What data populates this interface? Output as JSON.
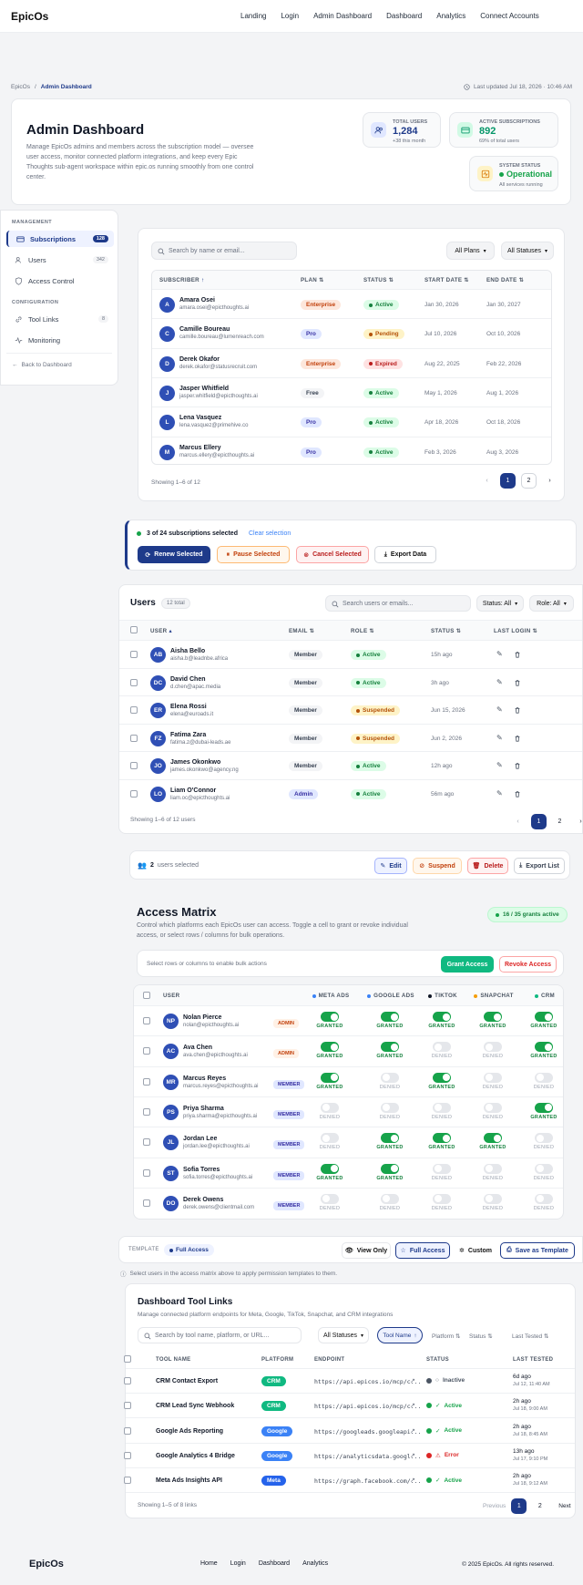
{
  "nav": {
    "brand": "EpicOs",
    "links": [
      "Landing",
      "Login",
      "Admin Dashboard",
      "Dashboard",
      "Analytics",
      "Connect Accounts"
    ]
  },
  "breadcrumb": {
    "root": "EpicOs",
    "sep": "/",
    "current": "Admin Dashboard"
  },
  "last_updated": "Last updated Jul 18, 2026 · 10:46 AM",
  "hero": {
    "title": "Admin Dashboard",
    "description": "Manage EpicOs admins and members across the subscription model — oversee user access, monitor connected platform integrations, and keep every Epic Thoughts sub-agent workspace within epic.os running smoothly from one control center."
  },
  "stats": [
    {
      "label": "TOTAL USERS",
      "value": "1,284",
      "sub": "+38 this month",
      "color": "#1e3a8a"
    },
    {
      "label": "ACTIVE SUBSCRIPTIONS",
      "value": "892",
      "sub": "69% of total users",
      "color": "#059669"
    },
    {
      "label": "SYSTEM STATUS",
      "value": "Operational",
      "sub": "All services running",
      "color": "#16a34a"
    }
  ],
  "sidebar": {
    "section1": "MANAGEMENT",
    "items1": [
      {
        "label": "Subscriptions",
        "badge": "128"
      },
      {
        "label": "Users",
        "badge": "342"
      },
      {
        "label": "Access Control",
        "badge": ""
      }
    ],
    "section2": "CONFIGURATION",
    "items2": [
      {
        "label": "Tool Links",
        "badge": "8"
      },
      {
        "label": "Monitoring",
        "badge": ""
      }
    ],
    "back": "Back to Dashboard"
  },
  "subs": {
    "search_placeholder": "Search by name or email...",
    "filter1": "All Plans",
    "filter2": "All Statuses",
    "headers": [
      "SUBSCRIBER",
      "PLAN",
      "STATUS",
      "START DATE",
      "END DATE"
    ],
    "rows": [
      {
        "initial": "A",
        "name": "Amara Osei",
        "email": "amara.osei@epicthoughts.ai",
        "plan": "Enterprise",
        "plan_cls": "p-ent",
        "status": "Active",
        "st_cls": "st-active",
        "start": "Jan 30, 2026",
        "end": "Jan 30, 2027"
      },
      {
        "initial": "C",
        "name": "Camille Boureau",
        "email": "camille.boureau@lumenreach.com",
        "plan": "Pro",
        "plan_cls": "p-pro",
        "status": "Pending",
        "st_cls": "st-pend",
        "start": "Jul 10, 2026",
        "end": "Oct 10, 2026"
      },
      {
        "initial": "D",
        "name": "Derek Okafor",
        "email": "derek.okafor@statusrecruit.com",
        "plan": "Enterprise",
        "plan_cls": "p-ent",
        "status": "Expired",
        "st_cls": "st-exp",
        "start": "Aug 22, 2025",
        "end": "Feb 22, 2026"
      },
      {
        "initial": "J",
        "name": "Jasper Whitfield",
        "email": "jasper.whitfield@epicthoughts.ai",
        "plan": "Free",
        "plan_cls": "p-free",
        "status": "Active",
        "st_cls": "st-active",
        "start": "May 1, 2026",
        "end": "Aug 1, 2026"
      },
      {
        "initial": "L",
        "name": "Lena Vasquez",
        "email": "lena.vasquez@primehive.co",
        "plan": "Pro",
        "plan_cls": "p-pro",
        "status": "Active",
        "st_cls": "st-active",
        "start": "Apr 18, 2026",
        "end": "Oct 18, 2026"
      },
      {
        "initial": "M",
        "name": "Marcus Ellery",
        "email": "marcus.ellery@epicthoughts.ai",
        "plan": "Pro",
        "plan_cls": "p-pro",
        "status": "Active",
        "st_cls": "st-active",
        "start": "Feb 3, 2026",
        "end": "Aug 3, 2026"
      }
    ],
    "showing": "Showing 1–6 of 12",
    "pages": [
      "1",
      "2"
    ]
  },
  "bulk": {
    "text": "3 of 24 subscriptions selected",
    "clear": "Clear selection",
    "renew": "Renew Selected",
    "pause": "Pause Selected",
    "cancel": "Cancel Selected",
    "export": "Export Data"
  },
  "users": {
    "title": "Users",
    "count": "12 total",
    "search_placeholder": "Search users or emails...",
    "filter_status": "Status: All",
    "filter_role": "Role: All",
    "headers": [
      "USER",
      "EMAIL",
      "ROLE",
      "STATUS",
      "LAST LOGIN"
    ],
    "rows": [
      {
        "initials": "AB",
        "name": "Aisha Bello",
        "email": "aisha.b@leadnbe.africa",
        "role": "Member",
        "status": "Active",
        "st_cls": "st-active",
        "last": "15h ago"
      },
      {
        "initials": "DC",
        "name": "David Chen",
        "email": "d.chen@apac.media",
        "role": "Member",
        "status": "Active",
        "st_cls": "st-active",
        "last": "3h ago"
      },
      {
        "initials": "ER",
        "name": "Elena Rossi",
        "email": "elena@euroads.it",
        "role": "Member",
        "status": "Suspended",
        "st_cls": "st-sus",
        "last": "Jun 15, 2026"
      },
      {
        "initials": "FZ",
        "name": "Fatima Zara",
        "email": "fatima.z@dubai-leads.ae",
        "role": "Member",
        "status": "Suspended",
        "st_cls": "st-sus",
        "last": "Jun 2, 2026"
      },
      {
        "initials": "JO",
        "name": "James Okonkwo",
        "email": "james.okonkwo@agency.ng",
        "role": "Member",
        "status": "Active",
        "st_cls": "st-active",
        "last": "12h ago"
      },
      {
        "initials": "LO",
        "name": "Liam O'Connor",
        "email": "liam.oc@epicthoughts.ai",
        "role": "Admin",
        "status": "Active",
        "st_cls": "st-active",
        "last": "56m ago"
      }
    ],
    "showing": "Showing 1–6 of 12 users",
    "pages": [
      "1",
      "2"
    ]
  },
  "users_bulk": {
    "count": "2",
    "text": "users selected",
    "edit": "Edit",
    "suspend": "Suspend",
    "delete": "Delete",
    "export": "Export List"
  },
  "matrix": {
    "title": "Access Matrix",
    "description": "Control which platforms each EpicOs user can access. Toggle a cell to grant or revoke individual access, or select rows / columns for bulk operations.",
    "badge": "16 / 35 grants active",
    "hint": "Select rows or columns to enable bulk actions",
    "grant": "Grant Access",
    "revoke": "Revoke Access",
    "user_header": "USER",
    "platforms": [
      {
        "name": "META ADS",
        "color": "#3b82f6"
      },
      {
        "name": "GOOGLE ADS",
        "color": "#3b82f6"
      },
      {
        "name": "TIKTOK",
        "color": "#111827"
      },
      {
        "name": "SNAPCHAT",
        "color": "#f59e0b"
      },
      {
        "name": "CRM",
        "color": "#10b981"
      }
    ],
    "granted_label": "GRANTED",
    "denied_label": "DENIED",
    "rows": [
      {
        "initials": "NP",
        "name": "Nolan Pierce",
        "email": "nolan@epicthoughts.ai",
        "role": "ADMIN",
        "grants": [
          1,
          1,
          1,
          1,
          1
        ]
      },
      {
        "initials": "AC",
        "name": "Ava Chen",
        "email": "ava.chen@epicthoughts.ai",
        "role": "ADMIN",
        "grants": [
          1,
          1,
          0,
          0,
          1
        ]
      },
      {
        "initials": "MR",
        "name": "Marcus Reyes",
        "email": "marcus.reyes@epicthoughts.ai",
        "role": "MEMBER",
        "grants": [
          1,
          0,
          1,
          0,
          0
        ]
      },
      {
        "initials": "PS",
        "name": "Priya Sharma",
        "email": "priya.sharma@epicthoughts.ai",
        "role": "MEMBER",
        "grants": [
          0,
          0,
          0,
          0,
          1
        ]
      },
      {
        "initials": "JL",
        "name": "Jordan Lee",
        "email": "jordan.lee@epicthoughts.ai",
        "role": "MEMBER",
        "grants": [
          0,
          1,
          1,
          1,
          0
        ]
      },
      {
        "initials": "ST",
        "name": "Sofia Torres",
        "email": "sofia.torres@epicthoughts.ai",
        "role": "MEMBER",
        "grants": [
          1,
          1,
          0,
          0,
          0
        ]
      },
      {
        "initials": "DO",
        "name": "Derek Owens",
        "email": "derek.owens@clientmail.com",
        "role": "MEMBER",
        "grants": [
          0,
          0,
          0,
          0,
          0
        ]
      }
    ]
  },
  "template": {
    "label": "TEMPLATE",
    "current": "Full Access",
    "view_only": "View Only",
    "full": "Full Access",
    "custom": "Custom",
    "save": "Save as Template",
    "hint": "Select users in the access matrix above to apply permission templates to them."
  },
  "tools": {
    "title": "Dashboard Tool Links",
    "description": "Manage connected platform endpoints for Meta, Google, TikTok, Snapchat, and CRM integrations",
    "search_placeholder": "Search by tool name, platform, or URL...",
    "filter": "All Statuses",
    "sort_active": "Tool Name",
    "sort_options": [
      "Platform",
      "Status",
      "Last Tested"
    ],
    "headers": [
      "TOOL NAME",
      "PLATFORM",
      "ENDPOINT",
      "STATUS",
      "LAST TESTED"
    ],
    "rows": [
      {
        "name": "CRM Contact Export",
        "platform": "CRM",
        "pcolor": "#10b981",
        "endpoint": "https://api.epicos.io/mcp/c...",
        "status": "Inactive",
        "scolor": "#4b5563",
        "last1": "6d ago",
        "last2": "Jul 12, 11:40 AM"
      },
      {
        "name": "CRM Lead Sync Webhook",
        "platform": "CRM",
        "pcolor": "#10b981",
        "endpoint": "https://api.epicos.io/mcp/c...",
        "status": "Active",
        "scolor": "#16a34a",
        "last1": "2h ago",
        "last2": "Jul 18, 9:00 AM"
      },
      {
        "name": "Google Ads Reporting",
        "platform": "Google",
        "pcolor": "#3b82f6",
        "endpoint": "https://googleads.googleapi...",
        "status": "Active",
        "scolor": "#16a34a",
        "last1": "2h ago",
        "last2": "Jul 18, 8:45 AM"
      },
      {
        "name": "Google Analytics 4 Bridge",
        "platform": "Google",
        "pcolor": "#3b82f6",
        "endpoint": "https://analyticsdata.googl...",
        "status": "Error",
        "scolor": "#dc2626",
        "last1": "13h ago",
        "last2": "Jul 17, 9:10 PM"
      },
      {
        "name": "Meta Ads Insights API",
        "platform": "Meta",
        "pcolor": "#2563eb",
        "endpoint": "https://graph.facebook.com/...",
        "status": "Active",
        "scolor": "#16a34a",
        "last1": "2h ago",
        "last2": "Jul 18, 9:12 AM"
      }
    ],
    "showing": "Showing 1–5 of 8 links",
    "prev": "Previous",
    "next": "Next",
    "pages": [
      "1",
      "2"
    ]
  },
  "footer": {
    "brand": "EpicOs",
    "links": [
      "Home",
      "Login",
      "Dashboard",
      "Analytics"
    ],
    "copyright": "© 2025 EpicOs. All rights reserved."
  }
}
